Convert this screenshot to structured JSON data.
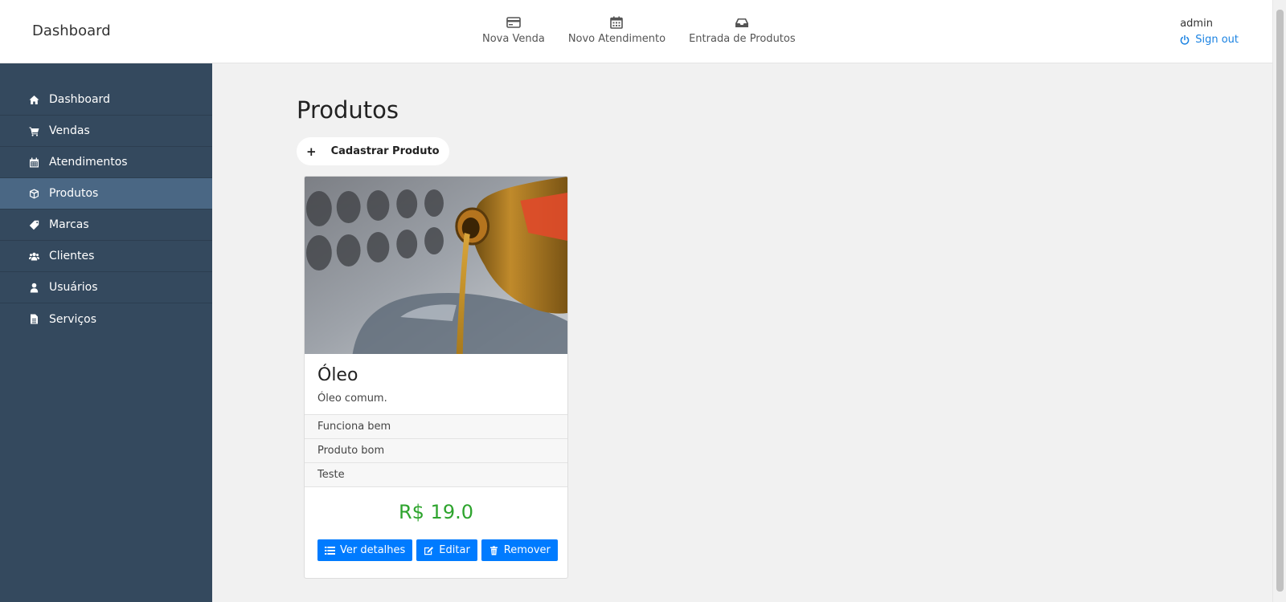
{
  "header": {
    "brand": "Dashboard",
    "quick_nav": [
      {
        "label": "Nova Venda",
        "icon": "credit-card-icon"
      },
      {
        "label": "Novo Atendimento",
        "icon": "calendar-icon"
      },
      {
        "label": "Entrada de Produtos",
        "icon": "inbox-icon"
      }
    ],
    "user": "admin",
    "signout_label": "Sign out"
  },
  "sidebar": {
    "items": [
      {
        "label": "Dashboard",
        "icon": "home-icon"
      },
      {
        "label": "Vendas",
        "icon": "cart-icon"
      },
      {
        "label": "Atendimentos",
        "icon": "calendar-icon"
      },
      {
        "label": "Produtos",
        "icon": "box-icon",
        "active": true
      },
      {
        "label": "Marcas",
        "icon": "tag-icon"
      },
      {
        "label": "Clientes",
        "icon": "users-icon"
      },
      {
        "label": "Usuários",
        "icon": "user-icon"
      },
      {
        "label": "Serviços",
        "icon": "file-icon"
      }
    ]
  },
  "main": {
    "title": "Produtos",
    "add_button": {
      "icon_text": "+",
      "label": "Cadastrar Produto"
    },
    "product": {
      "name": "Óleo",
      "description": "Óleo comum.",
      "features": [
        "Funciona bem",
        "Produto bom",
        "Teste"
      ],
      "price": "R$ 19.0",
      "actions": {
        "details": "Ver detalhes",
        "edit": "Editar",
        "remove": "Remover"
      }
    }
  },
  "colors": {
    "sidebar_bg": "#34495e",
    "sidebar_active": "#4a6784",
    "primary_button": "#007bff",
    "price": "#2ea42e",
    "link": "#1a82e2"
  }
}
